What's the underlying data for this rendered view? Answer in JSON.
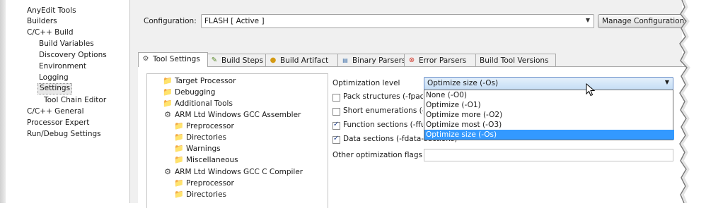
{
  "left_tree": {
    "items": [
      {
        "label": "AnyEdit Tools",
        "indent": 0
      },
      {
        "label": "Builders",
        "indent": 0
      },
      {
        "label": "C/C++ Build",
        "indent": 0
      },
      {
        "label": "Build Variables",
        "indent": 1
      },
      {
        "label": "Discovery Options",
        "indent": 1
      },
      {
        "label": "Environment",
        "indent": 1
      },
      {
        "label": "Logging",
        "indent": 1
      },
      {
        "label": "Settings",
        "indent": 1,
        "selected": true
      },
      {
        "label": "Tool Chain Editor",
        "indent": 1
      },
      {
        "label": "C/C++ General",
        "indent": 0
      },
      {
        "label": "Processor Expert",
        "indent": 0
      },
      {
        "label": "Run/Debug Settings",
        "indent": 0
      }
    ]
  },
  "configuration": {
    "label": "Configuration:",
    "value": "FLASH  [ Active ]",
    "manage_button": "Manage Configurations..."
  },
  "tabs": [
    {
      "label": "Tool Settings",
      "icon": "tool-settings-icon",
      "active": true
    },
    {
      "label": "Build Steps",
      "icon": "build-steps-icon"
    },
    {
      "label": "Build Artifact",
      "icon": "build-artifact-icon"
    },
    {
      "label": "Binary Parsers",
      "icon": "binary-parsers-icon"
    },
    {
      "label": "Error Parsers",
      "icon": "error-parsers-icon"
    },
    {
      "label": "Build Tool Versions",
      "icon": ""
    }
  ],
  "tool_tree": [
    {
      "label": "Target Processor",
      "level": 1,
      "icon": "folder-icon"
    },
    {
      "label": "Debugging",
      "level": 1,
      "icon": "folder-icon"
    },
    {
      "label": "Additional Tools",
      "level": 1,
      "icon": "folder-icon"
    },
    {
      "label": "ARM Ltd Windows GCC Assembler",
      "level": 1,
      "icon": "tool-icon"
    },
    {
      "label": "Preprocessor",
      "level": 2,
      "icon": "folder-icon"
    },
    {
      "label": "Directories",
      "level": 2,
      "icon": "folder-icon"
    },
    {
      "label": "Warnings",
      "level": 2,
      "icon": "folder-icon"
    },
    {
      "label": "Miscellaneous",
      "level": 2,
      "icon": "folder-icon"
    },
    {
      "label": "ARM Ltd Windows GCC C Compiler",
      "level": 1,
      "icon": "tool-icon"
    },
    {
      "label": "Preprocessor",
      "level": 2,
      "icon": "folder-icon"
    },
    {
      "label": "Directories",
      "level": 2,
      "icon": "folder-icon"
    }
  ],
  "optimization": {
    "level_label": "Optimization level",
    "level_value": "Optimize size (-Os)",
    "checkboxes": [
      {
        "label": "Pack structures (-fpack",
        "checked": false
      },
      {
        "label": "Short enumerations (-f",
        "checked": false
      },
      {
        "label": "Function sections (-ffu",
        "checked": true
      },
      {
        "label": "Data sections (-fdata-sections)",
        "checked": true
      }
    ],
    "other_flags_label": "Other optimization flags",
    "other_flags_value": "",
    "options": [
      {
        "label": "None (-O0)",
        "selected": false
      },
      {
        "label": "Optimize (-O1)",
        "selected": false
      },
      {
        "label": "Optimize more (-O2)",
        "selected": false
      },
      {
        "label": "Optimize most (-O3)",
        "selected": false
      },
      {
        "label": "Optimize size (-Os)",
        "selected": true
      }
    ]
  },
  "colors": {
    "selection": "#3399ff",
    "folder": "#e0a82e",
    "combo_highlight": "#c5ddf5"
  }
}
